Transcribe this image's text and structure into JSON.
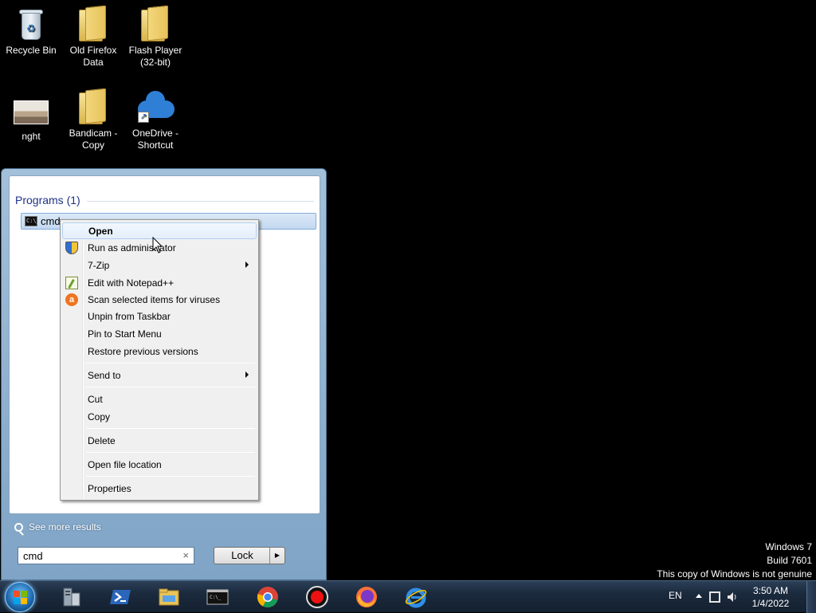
{
  "desktop": {
    "icons": [
      {
        "label": "Recycle Bin"
      },
      {
        "label": "Old Firefox Data"
      },
      {
        "label": "Flash Player (32-bit)"
      },
      {
        "label": "nght"
      },
      {
        "label": "Bandicam - Copy"
      },
      {
        "label": "OneDrive - Shortcut"
      }
    ]
  },
  "start_menu": {
    "programs_heading": "Programs (1)",
    "result": {
      "label": "cmd",
      "icon": "cmd-icon"
    },
    "see_more": "See more results",
    "search": {
      "value": "cmd",
      "clear_glyph": "×"
    },
    "power_button": {
      "label": "Lock",
      "arrow": "▶"
    }
  },
  "context_menu": {
    "items": [
      {
        "label": "Open",
        "bold": true,
        "highlighted": true
      },
      {
        "label": "Run as administrator",
        "icon": "uac-shield-icon"
      },
      {
        "label": "7-Zip",
        "submenu": true
      },
      {
        "label": "Edit with Notepad++",
        "icon": "notepad-plus-plus-icon"
      },
      {
        "label": "Scan selected items for viruses",
        "icon": "avast-icon"
      },
      {
        "label": "Unpin from Taskbar"
      },
      {
        "label": "Pin to Start Menu"
      },
      {
        "label": "Restore previous versions"
      },
      {
        "label": "Send to",
        "submenu": true
      },
      {
        "label": "Cut"
      },
      {
        "label": "Copy"
      },
      {
        "label": "Delete"
      },
      {
        "label": "Open file location"
      },
      {
        "label": "Properties"
      }
    ]
  },
  "watermark": {
    "line1": "Windows 7",
    "line2": "Build 7601",
    "line3": "This copy of Windows is not genuine"
  },
  "taskbar": {
    "pinned": [
      {
        "name": "server-manager-icon"
      },
      {
        "name": "powershell-icon"
      },
      {
        "name": "file-explorer-icon"
      },
      {
        "name": "command-prompt-icon"
      },
      {
        "name": "chrome-icon"
      },
      {
        "name": "bandicam-record-icon"
      },
      {
        "name": "firefox-icon"
      },
      {
        "name": "internet-explorer-icon"
      }
    ],
    "tray": {
      "language": "EN",
      "time": "3:50 AM",
      "date": "1/4/2022"
    }
  },
  "colors": {
    "desktop_bg": "#000000",
    "programs_heading": "#1e3287",
    "taskbar": "#1b2a3d"
  }
}
